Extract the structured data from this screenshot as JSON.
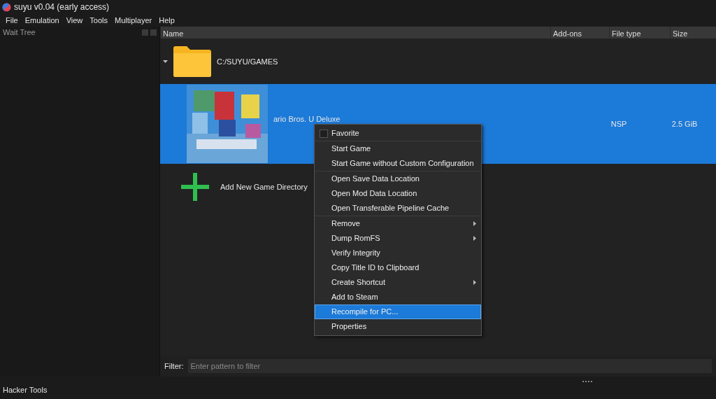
{
  "window": {
    "title": "suyu v0.04 (early access)"
  },
  "menubar": [
    {
      "label": "File"
    },
    {
      "label": "Emulation"
    },
    {
      "label": "View"
    },
    {
      "label": "Tools"
    },
    {
      "label": "Multiplayer"
    },
    {
      "label": "Help"
    }
  ],
  "left_dock": {
    "title": "Wait Tree"
  },
  "game_list": {
    "columns": [
      "Name",
      "Add-ons",
      "File type",
      "Size"
    ],
    "folder": {
      "path": "C:/SUYU/GAMES",
      "expanded": true
    },
    "games": [
      {
        "title": "ario Bros. U Deluxe",
        "file_type": "NSP",
        "size": "2.5 GiB",
        "selected": true
      }
    ],
    "add_directory": "Add New Game Directory"
  },
  "context_menu": {
    "groups": [
      [
        {
          "label": "Favorite",
          "kind": "check",
          "checked": false,
          "selected": false
        }
      ],
      [
        {
          "label": "Start Game",
          "kind": "action",
          "selected": false
        },
        {
          "label": "Start Game without Custom Configuration",
          "kind": "action",
          "selected": false
        }
      ],
      [
        {
          "label": "Open Save Data Location",
          "kind": "action",
          "selected": false
        },
        {
          "label": "Open Mod Data Location",
          "kind": "action",
          "selected": false
        },
        {
          "label": "Open Transferable Pipeline Cache",
          "kind": "action",
          "selected": false
        }
      ],
      [
        {
          "label": "Remove",
          "kind": "submenu",
          "selected": false
        },
        {
          "label": "Dump RomFS",
          "kind": "submenu",
          "selected": false
        },
        {
          "label": "Verify Integrity",
          "kind": "action",
          "selected": false
        },
        {
          "label": "Copy Title ID to Clipboard",
          "kind": "action",
          "selected": false
        },
        {
          "label": "Create Shortcut",
          "kind": "submenu",
          "selected": false
        },
        {
          "label": "Add to Steam",
          "kind": "action",
          "selected": false
        },
        {
          "label": "Recompile for PC...",
          "kind": "action",
          "selected": true
        },
        {
          "label": "Properties",
          "kind": "action",
          "selected": false
        }
      ]
    ]
  },
  "filter": {
    "label": "Filter:",
    "placeholder": "Enter pattern to filter"
  },
  "bottom_dock": {
    "title": "Hacker Tools"
  }
}
